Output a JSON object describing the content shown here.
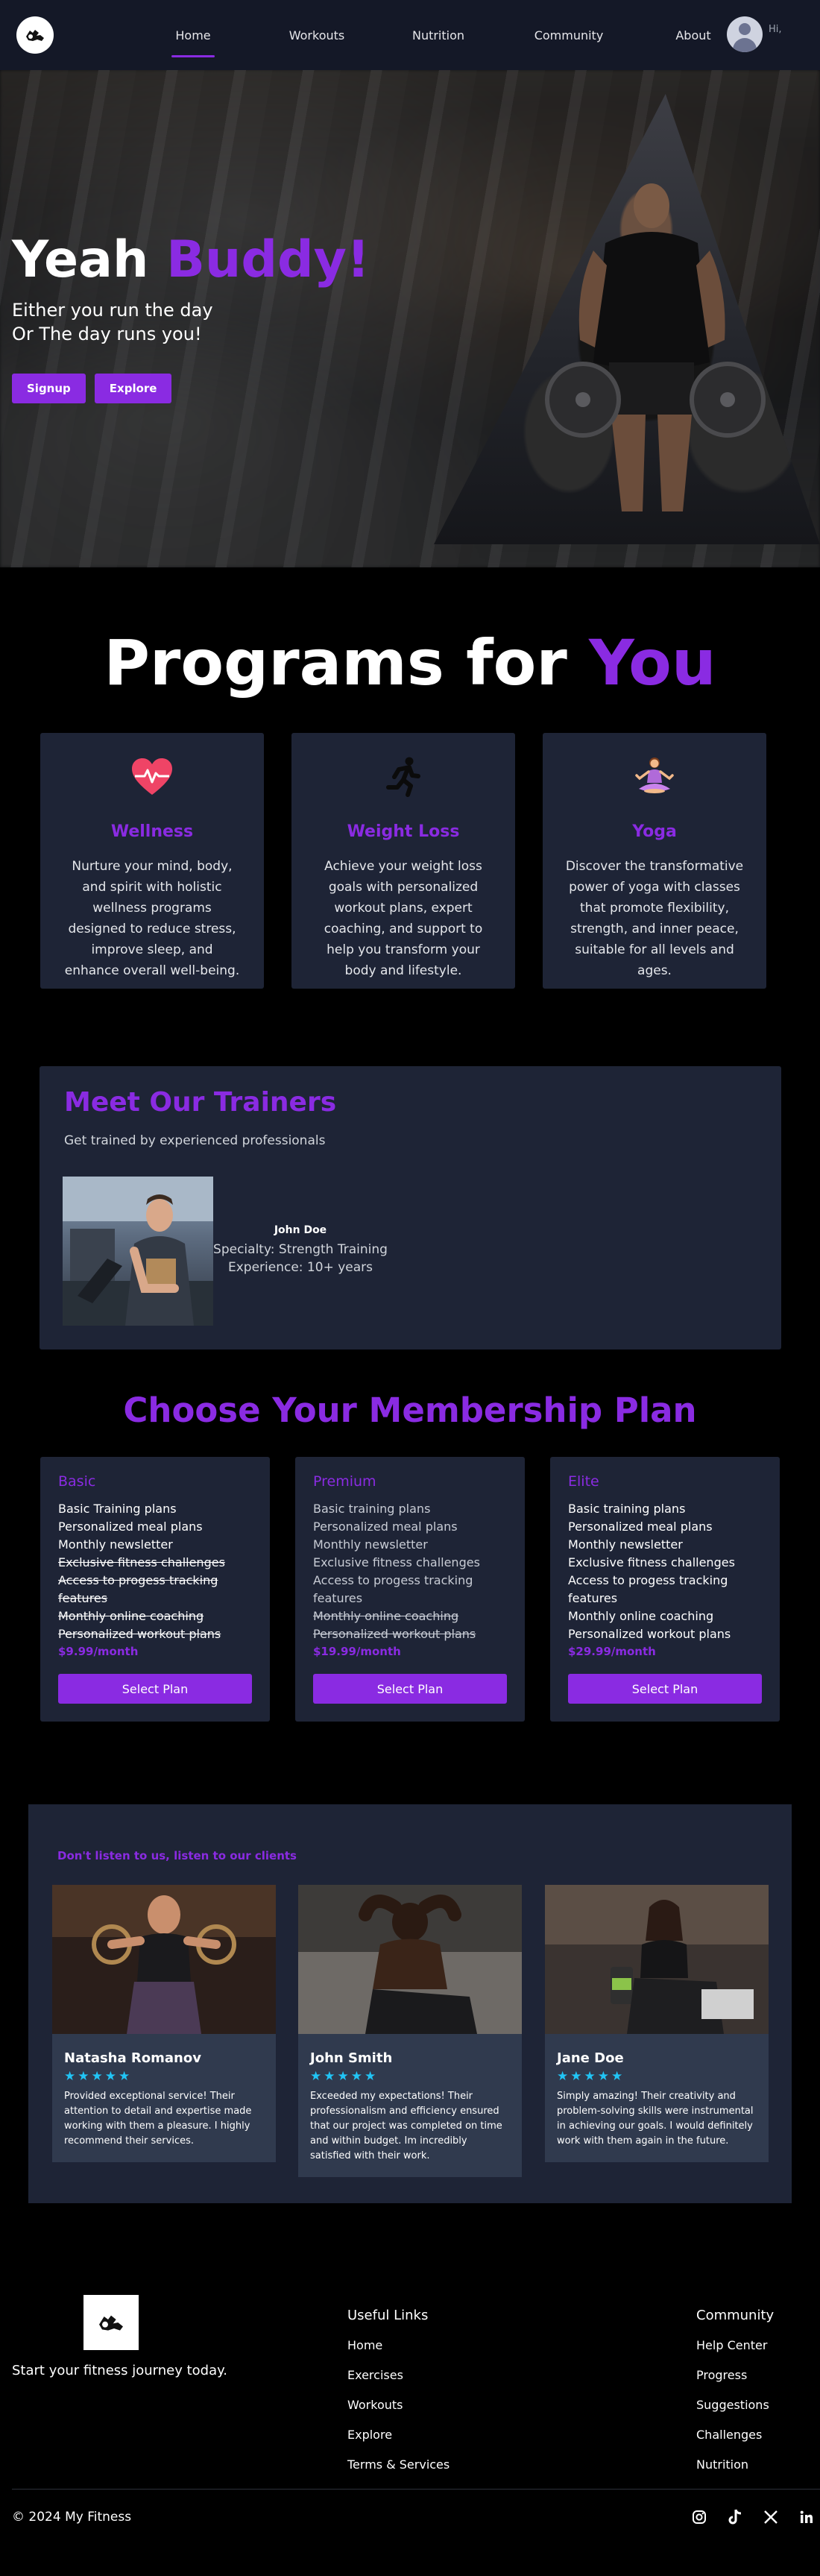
{
  "nav": {
    "links": [
      {
        "label": "Home",
        "active": true
      },
      {
        "label": "Workouts",
        "active": false
      },
      {
        "label": "Nutrition",
        "active": false
      },
      {
        "label": "Community",
        "active": false
      },
      {
        "label": "About",
        "active": false
      }
    ],
    "greeting": "Hi,"
  },
  "hero": {
    "title_main": "Yeah ",
    "title_accent": "Buddy!",
    "subtitle_line1": "Either you run the day",
    "subtitle_line2": "Or The day runs you!",
    "signup_label": "Signup",
    "explore_label": "Explore"
  },
  "programs": {
    "title_main": "Programs for ",
    "title_accent": "You",
    "items": [
      {
        "icon": "heart-pulse-icon",
        "name": "Wellness",
        "desc": "Nurture your mind, body, and spirit with holistic wellness programs designed to reduce stress, improve sleep, and enhance overall well-being."
      },
      {
        "icon": "runner-icon",
        "name": "Weight Loss",
        "desc": "Achieve your weight loss goals with personalized workout plans, expert coaching, and support to help you transform your body and lifestyle."
      },
      {
        "icon": "yoga-icon",
        "name": "Yoga",
        "desc": "Discover the transformative power of yoga with classes that promote flexibility, strength, and inner peace, suitable for all levels and ages."
      }
    ]
  },
  "trainers": {
    "title": "Meet Our Trainers",
    "subtitle": "Get trained by experienced professionals",
    "trainer": {
      "name": "John Doe",
      "specialty": "Specialty: Strength Training",
      "experience": "Experience: 10+ years"
    }
  },
  "membership": {
    "title": "Choose Your Membership Plan",
    "plans": [
      {
        "name": "Basic",
        "features": [
          {
            "text": "Basic Training plans",
            "included": true
          },
          {
            "text": "Personalized meal plans",
            "included": true
          },
          {
            "text": "Monthly newsletter",
            "included": true
          },
          {
            "text": "Exclusive fitness challenges",
            "included": false
          },
          {
            "text": "Access to progess tracking features",
            "included": false
          },
          {
            "text": "Monthly online coaching",
            "included": false
          },
          {
            "text": "Personalized workout plans",
            "included": false
          }
        ],
        "price": "$9.99/month",
        "button": "Select Plan"
      },
      {
        "name": "Premium",
        "features": [
          {
            "text": "Basic training plans",
            "included": true
          },
          {
            "text": "Personalized meal plans",
            "included": true
          },
          {
            "text": "Monthly newsletter",
            "included": true
          },
          {
            "text": "Exclusive fitness challenges",
            "included": true
          },
          {
            "text": "Access to progess tracking features",
            "included": true
          },
          {
            "text": "Monthly online coaching",
            "included": false
          },
          {
            "text": "Personalized workout plans",
            "included": false
          }
        ],
        "price": "$19.99/month",
        "button": "Select Plan"
      },
      {
        "name": "Elite",
        "features": [
          {
            "text": "Basic training plans",
            "included": true
          },
          {
            "text": "Personalized meal plans",
            "included": true
          },
          {
            "text": "Monthly newsletter",
            "included": true
          },
          {
            "text": "Exclusive fitness challenges",
            "included": true
          },
          {
            "text": "Access to progess tracking features",
            "included": true
          },
          {
            "text": "Monthly online coaching",
            "included": true
          },
          {
            "text": "Personalized workout plans",
            "included": true
          }
        ],
        "price": "$29.99/month",
        "button": "Select Plan"
      }
    ]
  },
  "testimonials": {
    "tagline": "Don't listen to us, listen to our clients",
    "items": [
      {
        "name": "Natasha Romanov",
        "rating": 5,
        "text": "Provided exceptional service! Their attention to detail and expertise made working with them a pleasure. I highly recommend their services."
      },
      {
        "name": "John Smith",
        "rating": 5,
        "text": "Exceeded my expectations! Their professionalism and efficiency ensured that our project was completed on time and within budget. Im incredibly satisfied with their work."
      },
      {
        "name": "Jane Doe",
        "rating": 5,
        "text": "Simply amazing! Their creativity and problem-solving skills were instrumental in achieving our goals. I would definitely work with them again in the future."
      }
    ]
  },
  "footer": {
    "tagline": "Start your fitness journey today.",
    "useful_links": {
      "title": "Useful Links",
      "links": [
        "Home",
        "Exercises",
        "Workouts",
        "Explore",
        "Terms & Services"
      ]
    },
    "community": {
      "title": "Community",
      "links": [
        "Help Center",
        "Progress",
        "Suggestions",
        "Challenges",
        "Nutrition"
      ]
    },
    "copyright": "© 2024 My Fitness",
    "socials": [
      "instagram-icon",
      "tiktok-icon",
      "x-icon",
      "linkedin-icon"
    ]
  },
  "colors": {
    "accent": "#8a2be2",
    "card": "#1e2436",
    "nav": "#141827",
    "star": "#21c4f5"
  }
}
